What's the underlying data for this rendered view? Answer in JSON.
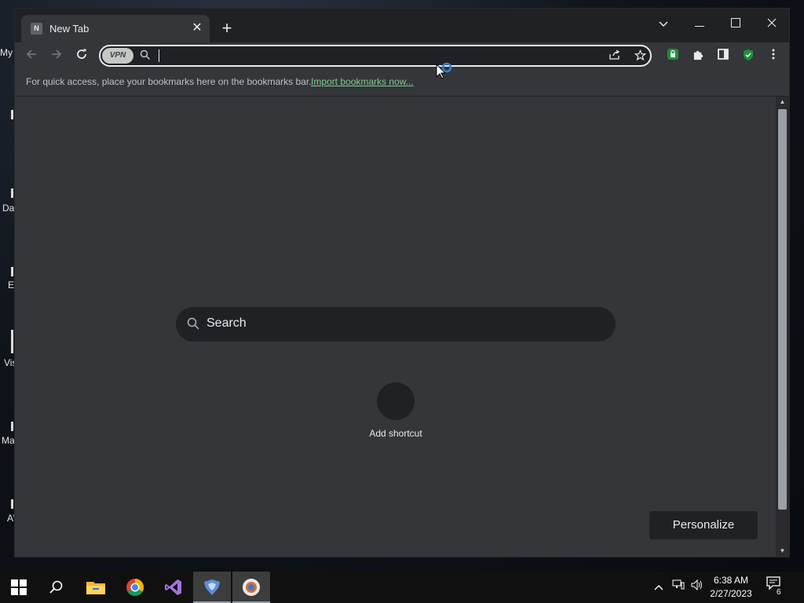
{
  "desktop": {
    "fragments": [
      "My",
      "Da",
      "E",
      "Vis",
      "Ma",
      "A\\"
    ]
  },
  "tab": {
    "favicon_letter": "N",
    "title": "New Tab",
    "close_glyph": "✕"
  },
  "toolbar": {
    "vpn_label": "VPN",
    "omnibox_value": ""
  },
  "bookmarks_bar": {
    "hint": "For quick access, place your bookmarks here on the bookmarks bar.",
    "import_link": "Import bookmarks now..."
  },
  "ntp": {
    "search_placeholder": "Search",
    "shortcut_label": "Add shortcut",
    "personalize_label": "Personalize"
  },
  "taskbar": {
    "clock_time": "6:38 AM",
    "clock_date": "2/27/2023",
    "notification_count": "6"
  },
  "colors": {
    "chrome_dark": "#202124",
    "chrome_surface": "#35363a",
    "text": "#e8eaed",
    "link": "#81c995",
    "shield_green": "#1e8e3e"
  }
}
